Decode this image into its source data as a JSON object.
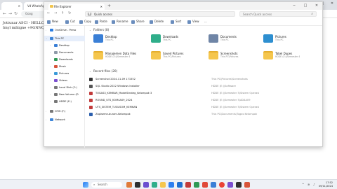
{
  "browser": {
    "tab1": "",
    "tab2": "Vd WhatsApp",
    "address": "Goog",
    "note_lines": [
      "Jottunar ASCI - HELLO",
      "Imyl mihigne +9GNNQ"
    ]
  },
  "explorer": {
    "tab_title": "File Explorer",
    "address": "Quick access",
    "search_placeholder": "Search Quick access",
    "commands": [
      "New",
      "Cut",
      "Copy",
      "Paste",
      "Rename",
      "Share",
      "Delete",
      "Sort",
      "View",
      "..."
    ]
  },
  "nav": [
    {
      "label": "OneDrive - Perso",
      "color": "#2b7de0"
    },
    {
      "label": "This PC",
      "color": "#3d85d8",
      "selected": true
    },
    {
      "label": "Desktop",
      "color": "#3a7fd6"
    },
    {
      "label": "Documents",
      "color": "#8e9aa8"
    },
    {
      "label": "Downloads",
      "color": "#2f9a55"
    },
    {
      "label": "Music",
      "color": "#d8553a"
    },
    {
      "label": "Pictures",
      "color": "#3a9ad8"
    },
    {
      "label": "Videos",
      "color": "#7b4fd0"
    },
    {
      "label": "Local Disk (C:)",
      "color": "#777"
    },
    {
      "label": "New Volume (D",
      "color": "#777"
    },
    {
      "label": "HDDE (E:)",
      "color": "#777"
    },
    {
      "label": "GTW (F:)",
      "color": "#777"
    },
    {
      "label": "Network",
      "color": "#3d85d8"
    }
  ],
  "sections": {
    "folders": "Folders (8)",
    "recent": "Recent files (20)"
  },
  "folders": [
    {
      "name": "Desktop",
      "sub": "This PC",
      "color": "#3a7fd6"
    },
    {
      "name": "Downloads",
      "sub": "This PC",
      "color": "#2fae8a"
    },
    {
      "name": "Documents",
      "sub": "This PC",
      "color": "#6f85a6"
    },
    {
      "name": "Pictures",
      "sub": "This PC",
      "color": "#2e8fd0"
    },
    {
      "name": "Manajemen Data Files",
      "sub": "HDDE (E:)\\Semester 4",
      "color": "#f5c64d"
    },
    {
      "name": "Saved Pictures",
      "sub": "This PC\\Pictures",
      "color": "#f5c64d"
    },
    {
      "name": "Screenshots",
      "sub": "This PC\\Pictures",
      "color": "#f5c64d"
    },
    {
      "name": "Tabel Dupes",
      "sub": "HDDE (E:)\\Semester 4",
      "color": "#f5c64d"
    }
  ],
  "files": [
    {
      "name": "Screenshot 2024-11-09 171552",
      "loc": "This PC\\Pictures\\Screenshots",
      "color": "#333"
    },
    {
      "name": "SQL Studio 2022 Windows Installer",
      "loc": "HDDE (E:)\\Software",
      "color": "#555"
    },
    {
      "name": "TUGAS3_KEMBAR_ModelStrateg_Kelompok 3",
      "loc": "HDDE (E:)\\Semester 5\\Sistem Operasi",
      "color": "#c23b3b"
    },
    {
      "name": "ROUND_UTS_KOM4A09_2024",
      "loc": "HDDE (E:)\\Semester 5\\AD4A09",
      "color": "#c23b3b"
    },
    {
      "name": "UTS_SISTEM_TUGUSOM_KEMKAN",
      "loc": "HDDE (E:)\\Semester 5\\Sistem Operasi",
      "color": "#c23b3b"
    },
    {
      "name": "Zapiseme-buram-Kelompok",
      "loc": "This PC\\Documents\\Tugas Kelompok",
      "color": "#2b5fad"
    }
  ],
  "taskbar": {
    "search": "Search",
    "time": "17:52",
    "date": "09/11/2024"
  }
}
